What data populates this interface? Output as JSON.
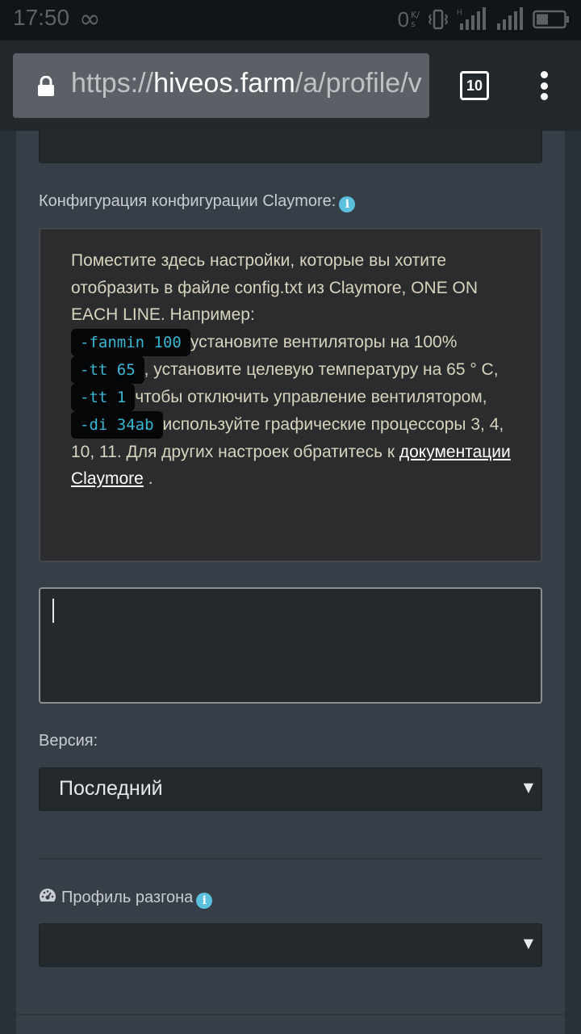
{
  "status_bar": {
    "time": "17:50",
    "infinity": "∞",
    "net_speed": "0",
    "net_unit_top": "K/",
    "net_unit_bottom": "s"
  },
  "browser": {
    "url_scheme": "https://",
    "url_host": "hiveos.farm",
    "url_path": "/a/profile/v",
    "tab_count": "10"
  },
  "form": {
    "claymore_label": "Конфигурация конфигурации Claymore:",
    "help": {
      "intro": "Поместите здесь настройки, которые вы хотите отобразить в файле config.txt из Claymore, ONE ON EACH LINE. Например:",
      "ex1_code": "-fanmin 100",
      "ex1_text": "установите вентиляторы на 100%",
      "ex2_code": "-tt 65",
      "ex2_text": ", установите целевую температуру на 65 ° C,",
      "ex3_code": "-tt 1",
      "ex3_text": "чтобы отключить управление вентилятором,",
      "ex4_code": "-di 34ab",
      "ex4_text": "используйте графические процессоры 3, 4, 10, 11. Для других настроек обратитесь к",
      "link_text": "документации Claymore",
      "end_text": "."
    },
    "config_textarea_value": "",
    "version_label": "Версия:",
    "version_value": "Последний",
    "overclock_label": "Профиль разгона",
    "overclock_value": ""
  }
}
